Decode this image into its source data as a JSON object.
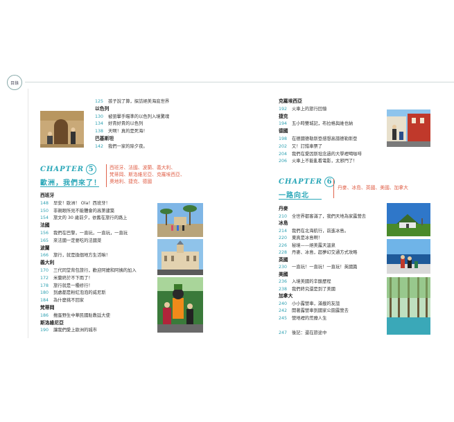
{
  "header": {
    "badge": "目錄"
  },
  "left_top": [
    {
      "type": "entry",
      "page": "125",
      "title": "孩子說了算，探訪絕美海底世界"
    },
    {
      "type": "sec",
      "title": "以色列"
    },
    {
      "type": "entry",
      "page": "130",
      "title": "被狙擊手瞄準的以色列入境驚魂"
    },
    {
      "type": "entry",
      "page": "134",
      "title": "好貴好貴的以色列"
    },
    {
      "type": "entry",
      "page": "138",
      "title": "天啊！真的是死海！"
    },
    {
      "type": "sec",
      "title": "巴基斯坦"
    },
    {
      "type": "entry",
      "page": "142",
      "title": "我們一家的除夕夜。"
    }
  ],
  "chapter5": {
    "label": "CHAPTER",
    "number": "5",
    "title": "歐洲，我們來了！",
    "regions_line1": "西班牙、法國、波蘭、義大利、",
    "regions_line2": "梵蒂岡、斯洛維尼亞、克羅埃西亞、",
    "regions_line3": "奧地利、捷克、德國"
  },
  "left_bottom": [
    {
      "type": "sec",
      "title": "西班牙"
    },
    {
      "type": "entry",
      "page": "148",
      "title": "早安！歐洲！ Ola！西班牙！"
    },
    {
      "type": "entry",
      "page": "150",
      "title": "非親眼所見不能體會的高第建築"
    },
    {
      "type": "entry",
      "page": "154",
      "title": "旅文的 30 歲前夕，依舊在旅行的路上"
    },
    {
      "type": "sec",
      "title": "法國"
    },
    {
      "type": "entry",
      "page": "156",
      "title": "我們在巴黎，一直玩，一直玩，一直玩"
    },
    {
      "type": "entry",
      "page": "165",
      "title": "來法國一定要吃的法國菜"
    },
    {
      "type": "sec",
      "title": "波蘭"
    },
    {
      "type": "entry",
      "page": "166",
      "title": "旅行，就是換個地方生活嘛！"
    },
    {
      "type": "sec",
      "title": "義大利"
    },
    {
      "type": "entry",
      "page": "170",
      "title": "三代同堂背包旅行，歡迎阿嬤和阿姨的加入"
    },
    {
      "type": "entry",
      "page": "172",
      "title": "米蘭終於不下雨了！"
    },
    {
      "type": "entry",
      "page": "178",
      "title": "旅行就是一種修行！"
    },
    {
      "type": "entry",
      "page": "180",
      "title": "到處都是粉紅泡泡的威尼斯"
    },
    {
      "type": "entry",
      "page": "184",
      "title": "為什麼挑不回家"
    },
    {
      "type": "sec",
      "title": "梵蒂岡"
    },
    {
      "type": "entry",
      "page": "186",
      "title": "搗蛋野生中華民國駐教廷大使"
    },
    {
      "type": "sec",
      "title": "斯洛維尼亞"
    },
    {
      "type": "entry",
      "page": "190",
      "title": "讓我們愛上歐洲的城市"
    }
  ],
  "right_top": [
    {
      "type": "sec",
      "title": "克羅埃西亞"
    },
    {
      "type": "entry",
      "page": "192",
      "title": "火車上的旅行回憶"
    },
    {
      "type": "sec",
      "title": "捷克"
    },
    {
      "type": "entry",
      "page": "194",
      "title": "五小時雙城記，布拉格與維也納"
    },
    {
      "type": "sec",
      "title": "德國"
    },
    {
      "type": "entry",
      "page": "198",
      "title": "在德國德勒斯登感想高譜德勒斯登"
    },
    {
      "type": "entry",
      "page": "202",
      "title": "又！訂錯車票了"
    },
    {
      "type": "entry",
      "page": "204",
      "title": "我們在愛因斯坦念過的大學裡喝咖啡"
    },
    {
      "type": "entry",
      "page": "206",
      "title": "火車上不能亂看電影，太邪門了！"
    }
  ],
  "chapter6": {
    "label": "CHAPTER",
    "number": "6",
    "title": "一路向北",
    "regions_line1": "丹麥、冰島、英國、美國、加拿大"
  },
  "right_bottom": [
    {
      "type": "sec",
      "title": "丹麥"
    },
    {
      "type": "entry",
      "page": "210",
      "title": "全世界都客滿了，我們天地為家露營去"
    },
    {
      "type": "sec",
      "title": "冰島"
    },
    {
      "type": "entry",
      "page": "214",
      "title": "我們在北海航行，前進冰島。"
    },
    {
      "type": "entry",
      "page": "220",
      "title": "東真是冰島啊！"
    },
    {
      "type": "entry",
      "page": "226",
      "title": "秘境——絕美露天溫泉"
    },
    {
      "type": "entry",
      "page": "228",
      "title": "丹麥、冰島，超夢幻交通方式攻略"
    },
    {
      "type": "sec",
      "title": "英國"
    },
    {
      "type": "entry",
      "page": "230",
      "title": "一直玩！一直玩！一直玩！英國篇"
    },
    {
      "type": "sec",
      "title": "美國"
    },
    {
      "type": "entry",
      "page": "236",
      "title": "入境美國的辛酸歷程"
    },
    {
      "type": "entry",
      "page": "238",
      "title": "我們終究還是到了美國"
    },
    {
      "type": "sec",
      "title": "加拿大"
    },
    {
      "type": "entry",
      "page": "240",
      "title": "小小露營車，滿載的友誼"
    },
    {
      "type": "entry",
      "page": "242",
      "title": "開著露營車到國家公園露營去"
    },
    {
      "type": "entry",
      "page": "245",
      "title": "營地裡的荒療人生"
    },
    {
      "type": "gap"
    },
    {
      "type": "entry",
      "page": "247",
      "title": "後記：還在旅途中"
    }
  ],
  "photos": [
    {
      "name": "photo-family-doorway",
      "subject": "family at wooden door"
    },
    {
      "name": "photo-gaudi-park",
      "subject": "palms and plaza"
    },
    {
      "name": "photo-palace",
      "subject": "palace facade"
    },
    {
      "name": "photo-goofy",
      "subject": "family with Goofy"
    },
    {
      "name": "photo-german-street",
      "subject": "family on street"
    },
    {
      "name": "photo-iceland-house",
      "subject": "turf house"
    },
    {
      "name": "photo-lake-boat",
      "subject": "family by lake"
    },
    {
      "name": "photo-forest-lake",
      "subject": "forest lake"
    }
  ],
  "colors": {
    "accent": "#2aa7b8",
    "regions": "#e0624a"
  }
}
